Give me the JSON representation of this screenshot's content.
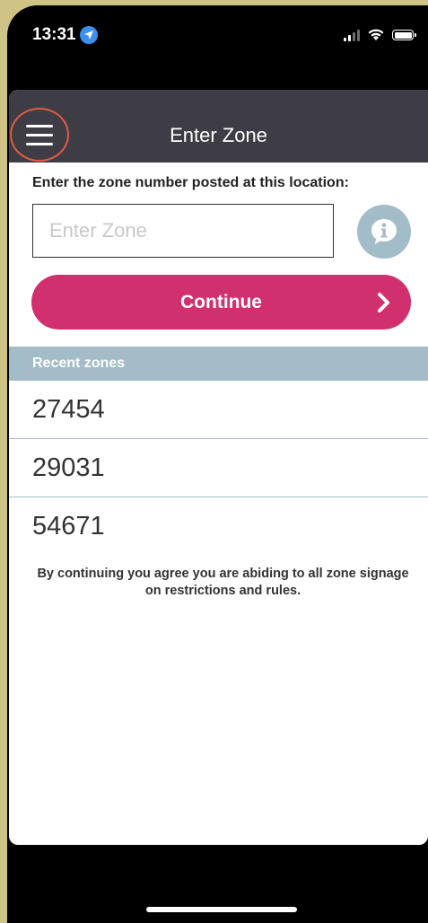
{
  "status_bar": {
    "time": "13:31"
  },
  "header": {
    "title": "Enter Zone"
  },
  "form": {
    "prompt": "Enter the zone number posted at this location:",
    "placeholder": "Enter Zone",
    "continue_label": "Continue"
  },
  "recent": {
    "header": "Recent zones",
    "items": [
      "27454",
      "29031",
      "54671"
    ]
  },
  "disclaimer": "By continuing you agree you are abiding to all zone signage on restrictions and rules.",
  "colors": {
    "header_bg": "#3e3d45",
    "accent": "#d1306f",
    "section_bg": "#a2bcc8",
    "menu_highlight": "#e05a46"
  },
  "icons": [
    "location-arrow-icon",
    "signal-icon",
    "wifi-icon",
    "battery-icon",
    "menu-icon",
    "info-icon",
    "chevron-right-icon"
  ]
}
